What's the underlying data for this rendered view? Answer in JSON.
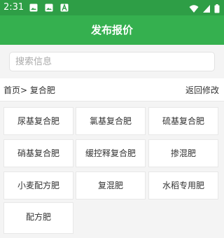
{
  "status_bar": {
    "time": "2:31",
    "icons": [
      "gallery-notification-icon",
      "gallery-notification-icon",
      "app-a-icon",
      "wifi-icon",
      "signal-icon",
      "battery-icon"
    ]
  },
  "header": {
    "title": "发布报价"
  },
  "search": {
    "placeholder": "搜索信息",
    "value": ""
  },
  "breadcrumb": {
    "text": "首页> 复合肥",
    "back_label": "返回修改"
  },
  "categories": [
    "尿基复合肥",
    "氯基复合肥",
    "硫基复合肥",
    "硝基复合肥",
    "缓控释复合肥",
    "掺混肥",
    "小麦配方肥",
    "复混肥",
    "水稻专用肥",
    "配方肥"
  ],
  "colors": {
    "status_bar": "#2e9e46",
    "app_bar": "#35b04f",
    "text": "#333333"
  }
}
